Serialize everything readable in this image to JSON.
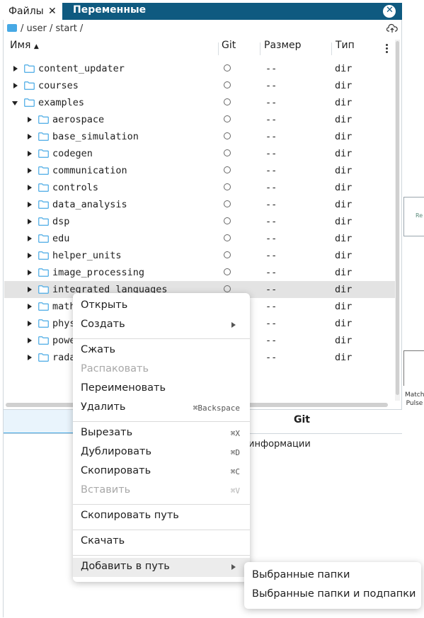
{
  "tabs": {
    "files": "Файлы",
    "files_close": "✕",
    "variables": "Переменные",
    "panel_close": "✕"
  },
  "breadcrumb": "/ user / start /",
  "columns": {
    "name": "Имя",
    "sort_arrow": "▲",
    "git": "Git",
    "size": "Размер",
    "type": "Тип"
  },
  "rows": [
    {
      "name": "content_updater",
      "size": "--",
      "type": "dir",
      "expanded": false,
      "level": 0
    },
    {
      "name": "courses",
      "size": "--",
      "type": "dir",
      "expanded": false,
      "level": 0
    },
    {
      "name": "examples",
      "size": "--",
      "type": "dir",
      "expanded": true,
      "level": 0
    },
    {
      "name": "aerospace",
      "size": "--",
      "type": "dir",
      "expanded": false,
      "level": 1
    },
    {
      "name": "base_simulation",
      "size": "--",
      "type": "dir",
      "expanded": false,
      "level": 1
    },
    {
      "name": "codegen",
      "size": "--",
      "type": "dir",
      "expanded": false,
      "level": 1
    },
    {
      "name": "communication",
      "size": "--",
      "type": "dir",
      "expanded": false,
      "level": 1
    },
    {
      "name": "controls",
      "size": "--",
      "type": "dir",
      "expanded": false,
      "level": 1
    },
    {
      "name": "data_analysis",
      "size": "--",
      "type": "dir",
      "expanded": false,
      "level": 1
    },
    {
      "name": "dsp",
      "size": "--",
      "type": "dir",
      "expanded": false,
      "level": 1
    },
    {
      "name": "edu",
      "size": "--",
      "type": "dir",
      "expanded": false,
      "level": 1
    },
    {
      "name": "helper_units",
      "size": "--",
      "type": "dir",
      "expanded": false,
      "level": 1
    },
    {
      "name": "image_processing",
      "size": "--",
      "type": "dir",
      "expanded": false,
      "level": 1
    },
    {
      "name": "integrated_languages",
      "size": "--",
      "type": "dir",
      "expanded": false,
      "level": 1,
      "selected": true
    },
    {
      "name": "math",
      "size": "--",
      "type": "dir",
      "expanded": false,
      "level": 1
    },
    {
      "name": "phys",
      "size": "--",
      "type": "dir",
      "expanded": false,
      "level": 1
    },
    {
      "name": "powe",
      "size": "--",
      "type": "dir",
      "expanded": false,
      "level": 1
    },
    {
      "name": "rada",
      "size": "--",
      "type": "dir",
      "expanded": false,
      "level": 1
    }
  ],
  "git_panel": {
    "title": "Git",
    "info": "информации"
  },
  "context_menu": {
    "open": "Открыть",
    "create": "Создать",
    "compress": "Сжать",
    "extract": "Распаковать",
    "rename": "Переименовать",
    "delete": "Удалить",
    "delete_key": "⌘Backspace",
    "cut": "Вырезать",
    "cut_key": "⌘X",
    "duplicate": "Дублировать",
    "duplicate_key": "⌘D",
    "copy": "Скопировать",
    "copy_key": "⌘C",
    "paste": "Вставить",
    "paste_key": "⌘V",
    "copy_path": "Скопировать путь",
    "download": "Скачать",
    "add_to_path": "Добавить в путь"
  },
  "submenu": {
    "selected_folders": "Выбранные папки",
    "selected_folders_sub": "Выбранные папки и подпапки"
  },
  "background": {
    "box_text": "Re",
    "bottom_text_1": "Matche",
    "bottom_text_2": "Pulse"
  },
  "colors": {
    "tabbar": "#0f5a80",
    "folder_blue": "#47a9e5",
    "selection": "#e3e3e3"
  }
}
